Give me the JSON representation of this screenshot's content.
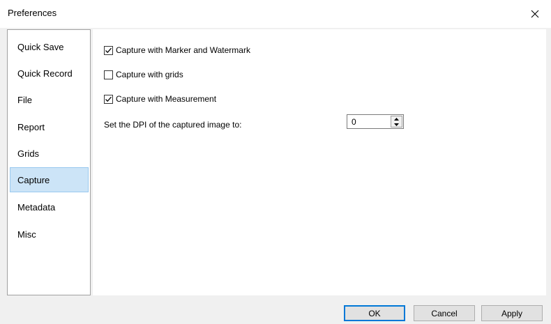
{
  "window": {
    "title": "Preferences"
  },
  "sidebar": {
    "items": [
      {
        "label": "Quick Save",
        "selected": false
      },
      {
        "label": "Quick Record",
        "selected": false
      },
      {
        "label": "File",
        "selected": false
      },
      {
        "label": "Report",
        "selected": false
      },
      {
        "label": "Grids",
        "selected": false
      },
      {
        "label": "Capture",
        "selected": true
      },
      {
        "label": "Metadata",
        "selected": false
      },
      {
        "label": "Misc",
        "selected": false
      }
    ]
  },
  "capture": {
    "options": [
      {
        "label": "Capture with Marker and Watermark",
        "checked": true
      },
      {
        "label": "Capture with grids",
        "checked": false
      },
      {
        "label": "Capture with Measurement",
        "checked": true
      }
    ],
    "dpi_label": "Set the DPI of the captured image to:",
    "dpi_value": "0"
  },
  "buttons": {
    "ok": "OK",
    "cancel": "Cancel",
    "apply": "Apply"
  },
  "colors": {
    "selected_bg": "#cce4f7",
    "selected_border": "#99c9ef",
    "default_button_border": "#0078d7"
  },
  "icons": {
    "close": "close-icon",
    "check": "checkmark-icon",
    "spin_up": "triangle-up-icon",
    "spin_down": "triangle-down-icon"
  }
}
